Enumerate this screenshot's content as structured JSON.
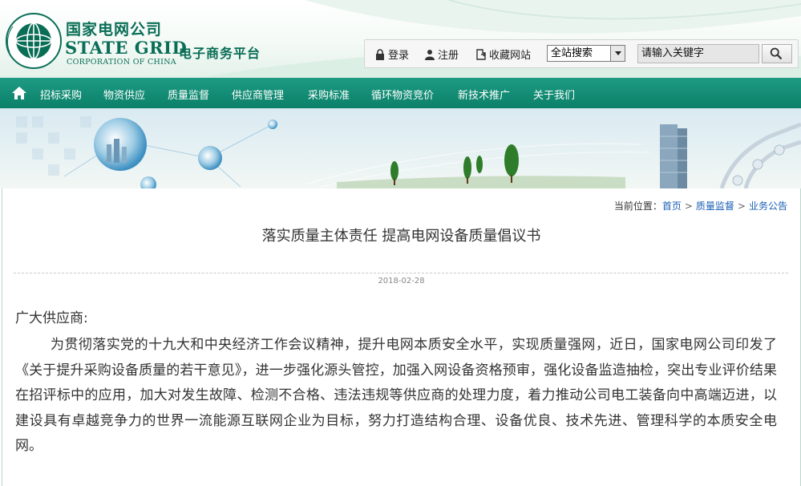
{
  "header": {
    "cn_name": "国家电网公司",
    "en_name": "STATE GRID",
    "en_sub": "CORPORATION OF CHINA",
    "emblem_ring_text": "STATE GRID CORPORATION OF CHINA",
    "platform": "电子商务平台"
  },
  "toolbar": {
    "login": "登录",
    "register": "注册",
    "favorite": "收藏网站",
    "scope_selected": "全站搜索",
    "search_value": "请输入关键字"
  },
  "nav": {
    "items": [
      "招标采购",
      "物资供应",
      "质量监督",
      "供应商管理",
      "采购标准",
      "循环物资竞价",
      "新技术推广",
      "关于我们"
    ]
  },
  "breadcrumb": {
    "prefix": "当前位置：",
    "items": [
      "首页",
      "质量监督",
      "业务公告"
    ]
  },
  "article": {
    "title": "落实质量主体责任 提高电网设备质量倡议书",
    "date": "2018-02-28",
    "greeting": "广大供应商:",
    "paragraph": "为贯彻落实党的十九大和中央经济工作会议精神，提升电网本质安全水平，实现质量强网，近日，国家电网公司印发了《关于提升采购设备质量的若干意见》，进一步强化源头管控，加强入网设备资格预审，强化设备监造抽检，突出专业评价结果在招评标中的应用，加大对发生故障、检测不合格、违法违规等供应商的处理力度，着力推动公司电工装备向中高端迈进，以建设具有卓越竞争力的世界一流能源互联网企业为目标，努力打造结构合理、设备优良、技术先进、管理科学的本质安全电网。"
  },
  "colors": {
    "brand_green": "#0a6e57",
    "nav_bg": "#0b8069",
    "link_blue": "#1a5fb4"
  }
}
